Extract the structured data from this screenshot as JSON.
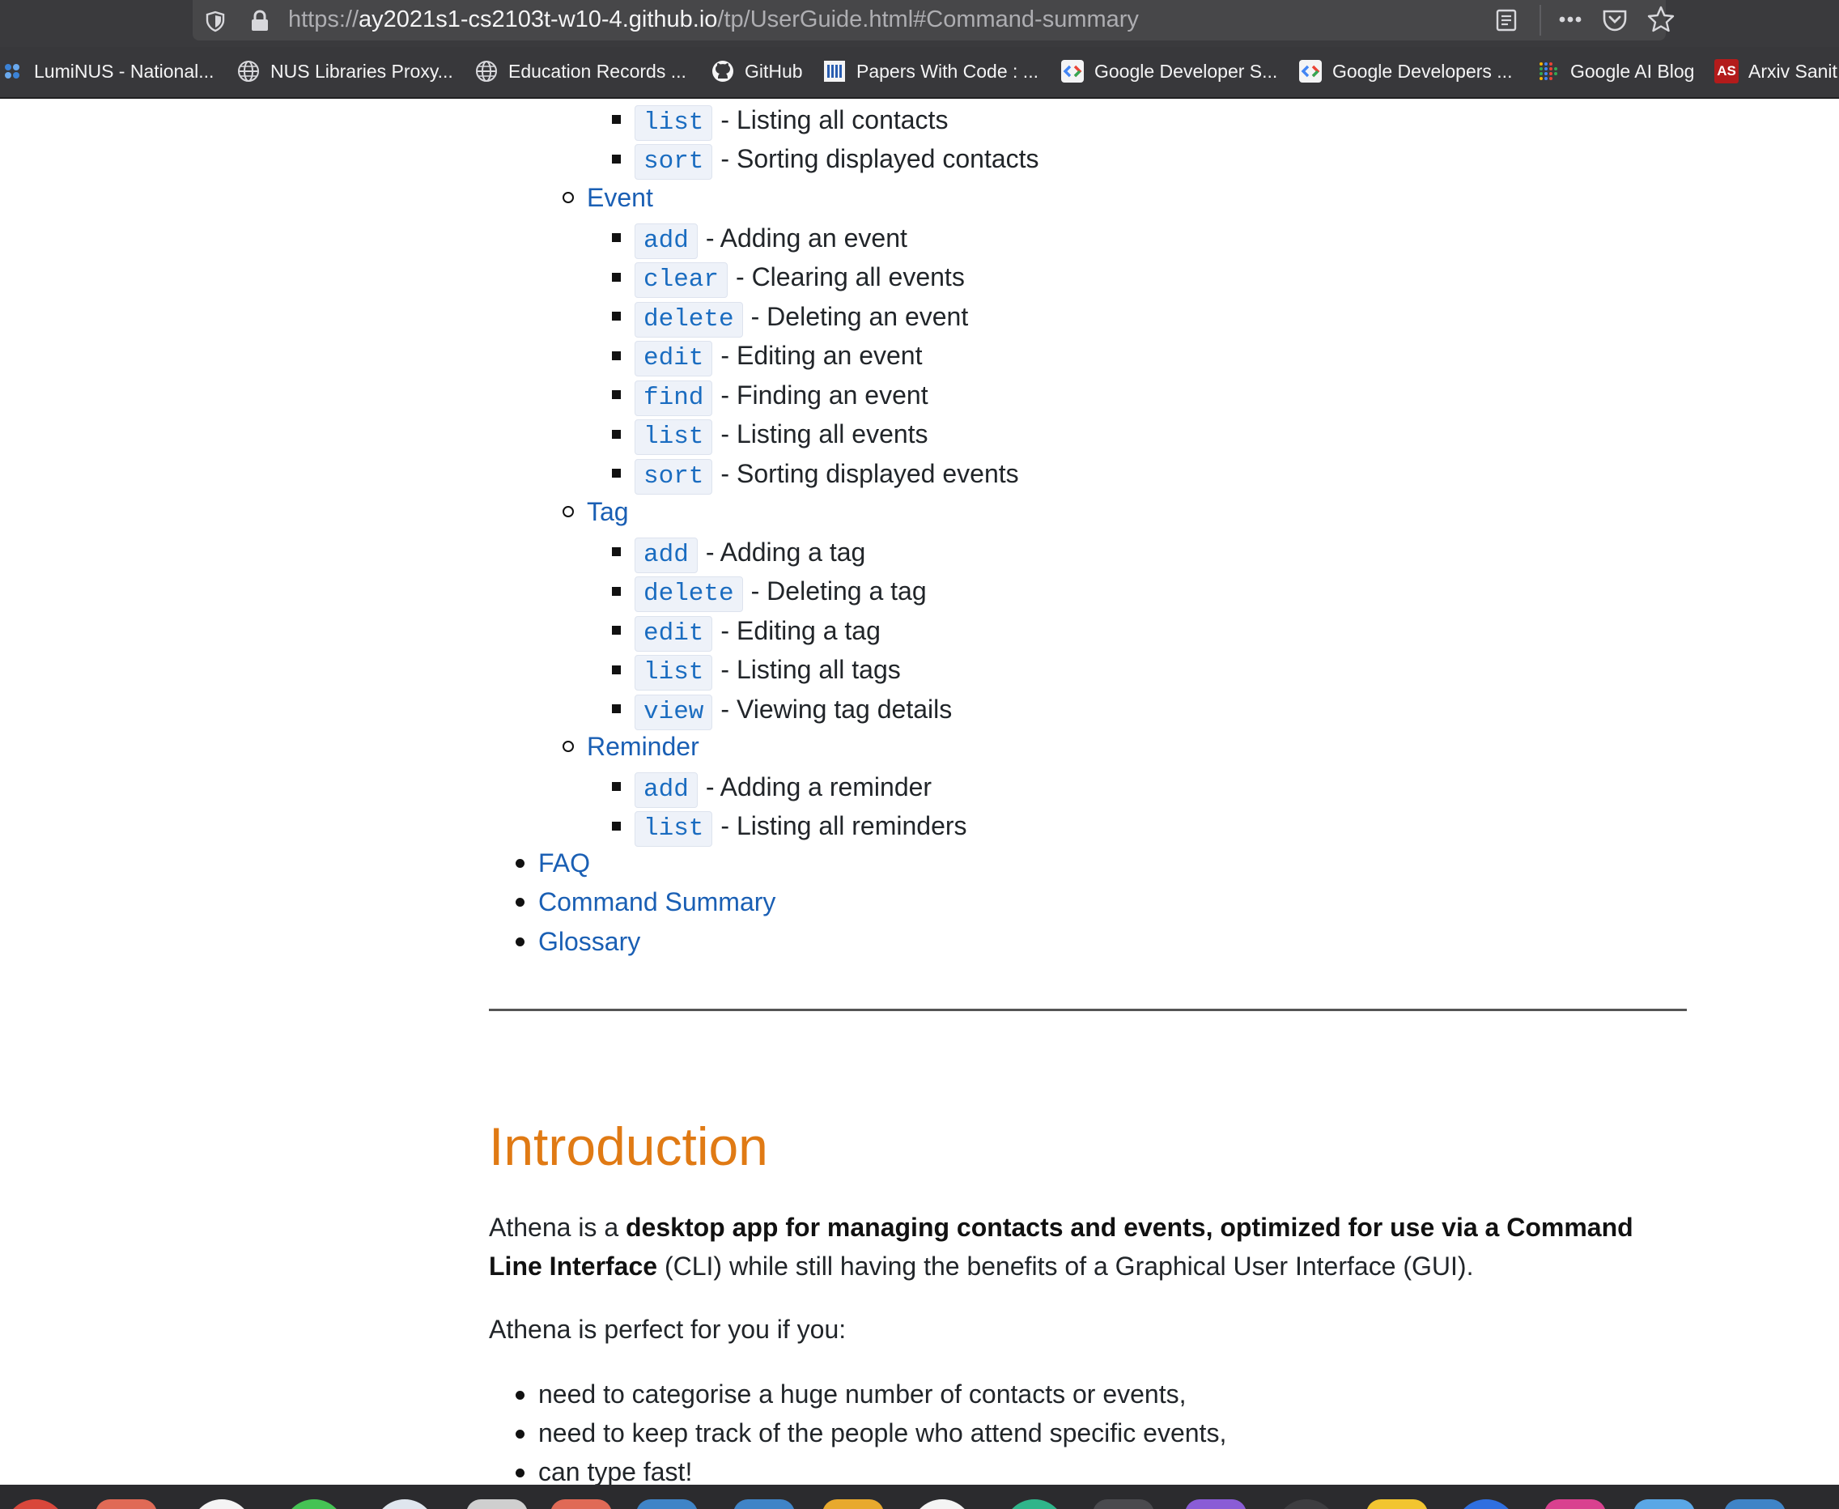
{
  "browser": {
    "url_prefix": "https://",
    "url_host": "ay2021s1-cs2103t-w10-4.github.io",
    "url_path": "/tp/UserGuide.html#Command-summary",
    "bookmarks": [
      {
        "label": "LumiNUS - National...",
        "icon": "luminus-icon"
      },
      {
        "label": "NUS Libraries Proxy...",
        "icon": "globe-icon"
      },
      {
        "label": "Education Records ...",
        "icon": "globe-icon"
      },
      {
        "label": "GitHub",
        "icon": "github-icon"
      },
      {
        "label": "Papers With Code : ...",
        "icon": "paperswithcode-icon"
      },
      {
        "label": "Google Developer S...",
        "icon": "google-developers-icon"
      },
      {
        "label": "Google Developers ...",
        "icon": "google-developers-icon"
      },
      {
        "label": "Google AI Blog",
        "icon": "google-ai-icon"
      },
      {
        "label": "Arxiv Sanit",
        "icon": "arxiv-sanity-icon",
        "badge": "AS"
      }
    ]
  },
  "toc": {
    "contact_tail": [
      {
        "cmd": "list",
        "desc": "- Listing all contacts"
      },
      {
        "cmd": "sort",
        "desc": "- Sorting displayed contacts"
      }
    ],
    "event": {
      "label": "Event",
      "items": [
        {
          "cmd": "add",
          "desc": "- Adding an event"
        },
        {
          "cmd": "clear",
          "desc": "- Clearing all events"
        },
        {
          "cmd": "delete",
          "desc": "- Deleting an event"
        },
        {
          "cmd": "edit",
          "desc": "- Editing an event"
        },
        {
          "cmd": "find",
          "desc": "- Finding an event"
        },
        {
          "cmd": "list",
          "desc": "- Listing all events"
        },
        {
          "cmd": "sort",
          "desc": "- Sorting displayed events"
        }
      ]
    },
    "tag": {
      "label": "Tag",
      "items": [
        {
          "cmd": "add",
          "desc": "- Adding a tag"
        },
        {
          "cmd": "delete",
          "desc": "- Deleting a tag"
        },
        {
          "cmd": "edit",
          "desc": "- Editing a tag"
        },
        {
          "cmd": "list",
          "desc": "- Listing all tags"
        },
        {
          "cmd": "view",
          "desc": "- Viewing tag details"
        }
      ]
    },
    "reminder": {
      "label": "Reminder",
      "items": [
        {
          "cmd": "add",
          "desc": "- Adding a reminder"
        },
        {
          "cmd": "list",
          "desc": "- Listing all reminders"
        }
      ]
    },
    "top_links": [
      "FAQ",
      "Command Summary",
      "Glossary"
    ]
  },
  "intro": {
    "heading": "Introduction",
    "p1_start": "Athena is a ",
    "p1_bold1": "desktop app for managing contacts and events, optimized for use via a Command",
    "p1_bold2": "Line Interface",
    "p1_end": " (CLI) while still having the benefits of a Graphical User Interface (GUI).",
    "p2": "Athena is perfect for you if you:",
    "bullets": [
      "need to categorise a huge number of contacts or events,",
      "need to keep track of the people who attend specific events,",
      "can type fast!"
    ]
  },
  "colors": {
    "link": "#1a5fb4",
    "heading": "#e07a14",
    "code_text": "#1a6cc0",
    "code_bg": "#eef2f9"
  }
}
